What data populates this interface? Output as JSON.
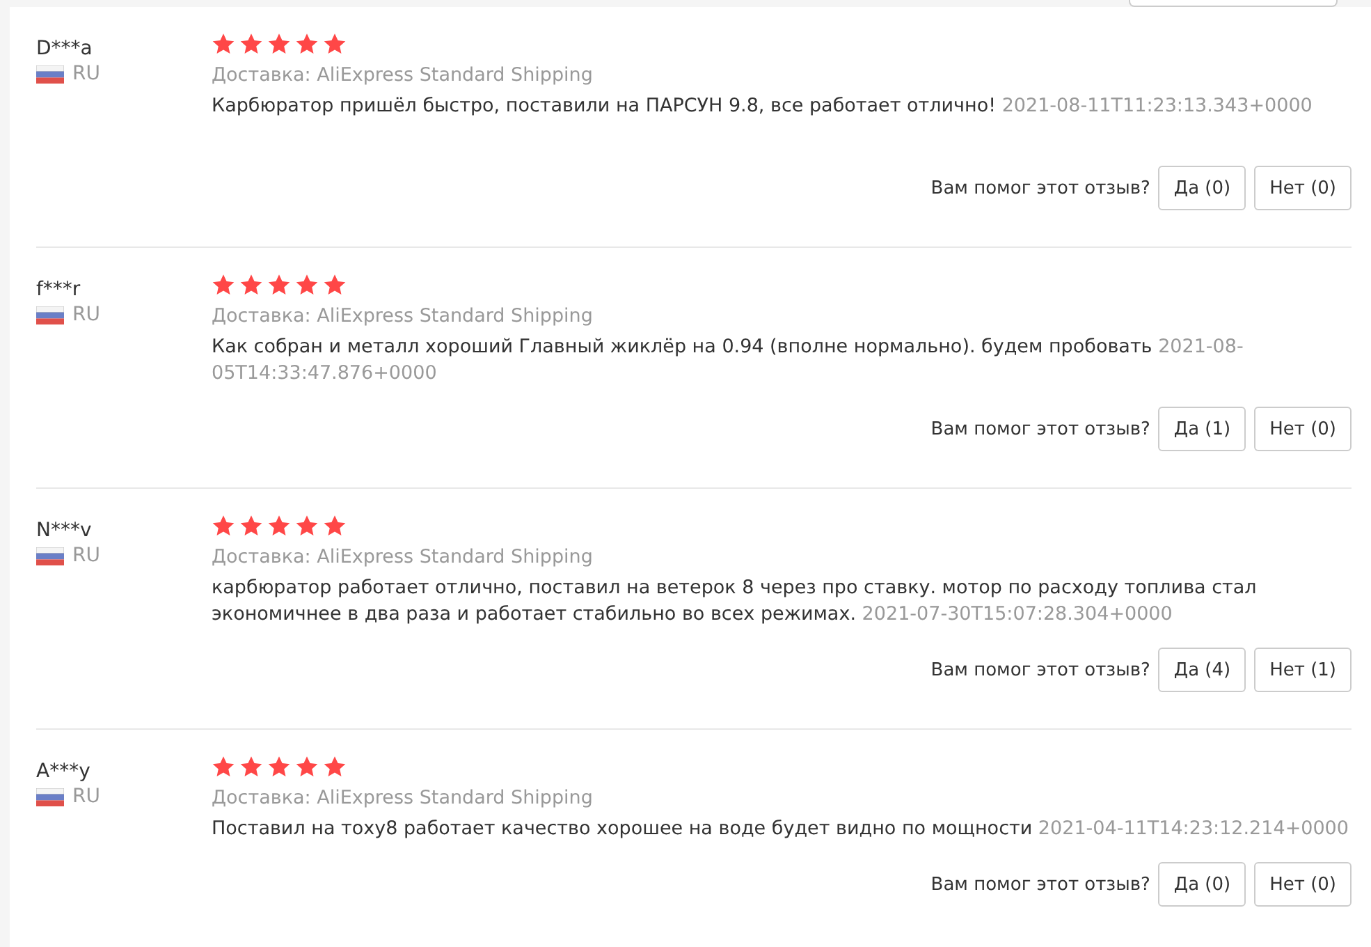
{
  "reviews": [
    {
      "author": "D***a",
      "country": "RU",
      "stars": 5,
      "shipping": "Доставка: AliExpress Standard Shipping",
      "text": "Карбюратор пришёл быстро, поставили на ПАРСУН 9.8, все работает отлично!",
      "date": "2021-08-11T11:23:13.343+0000",
      "helpful_prompt": "Вам помог этот отзыв?",
      "yes": "Да (0)",
      "no": "Нет (0)"
    },
    {
      "author": "f***r",
      "country": "RU",
      "stars": 5,
      "shipping": "Доставка: AliExpress Standard Shipping",
      "text": "Как собран и металл хороший Главный жиклёр на 0.94 (вполне нормально). будем пробовать",
      "date": "2021-08-05T14:33:47.876+0000",
      "helpful_prompt": "Вам помог этот отзыв?",
      "yes": "Да (1)",
      "no": "Нет (0)"
    },
    {
      "author": "N***v",
      "country": "RU",
      "stars": 5,
      "shipping": "Доставка: AliExpress Standard Shipping",
      "text": "карбюратор работает отлично, поставил на ветерок 8 через про ставку. мотор по расходу топлива стал экономичнее в два раза и работает стабильно во всех режимах.",
      "date": "2021-07-30T15:07:28.304+0000",
      "helpful_prompt": "Вам помог этот отзыв?",
      "yes": "Да (4)",
      "no": "Нет (1)"
    },
    {
      "author": "A***y",
      "country": "RU",
      "stars": 5,
      "shipping": "Доставка: AliExpress Standard Shipping",
      "text": "Поставил на тоху8 работает качество хорошее на воде будет видно по мощности",
      "date": "2021-04-11T14:23:12.214+0000",
      "helpful_prompt": "Вам помог этот отзыв?",
      "yes": "Да (0)",
      "no": "Нет (0)"
    }
  ]
}
